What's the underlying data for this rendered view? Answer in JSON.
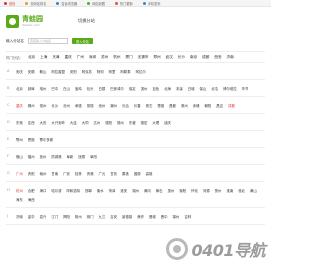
{
  "topbar": {
    "items": [
      "首页",
      "去网站排名",
      "告诉浏览器",
      "网站收藏",
      "热门更新",
      "手机发布"
    ],
    "colors": [
      "#d33",
      "#e0a020",
      "#2a8ad6",
      "#5aa919",
      "#e05050",
      "#2a8ad6"
    ]
  },
  "header": {
    "logo_title": "青蛙园",
    "logo_sub": "dxpoui.com",
    "city_switch": "切换分站"
  },
  "search": {
    "label": "输入分站名",
    "placeholder": "直接输入分站名",
    "button": "进入分站"
  },
  "hot": {
    "label": "热门分站：",
    "cities": [
      "北京",
      "上海",
      "天津",
      "重庆",
      "广州",
      "深圳",
      "苏州",
      "杭州",
      "厦门",
      "无锡市",
      "郑州",
      "武汉",
      "长沙",
      "南京",
      "成都",
      "西安",
      "济南"
    ]
  },
  "groups": [
    {
      "letter": "A",
      "cities": [
        "安庆",
        "安顺",
        "鞍山",
        "阿拉善盟",
        "安阳",
        "阿克苏",
        "阿坝",
        "阿里",
        "阿勒泰",
        "阿拉尔"
      ],
      "red": []
    },
    {
      "letter": "B",
      "cities": [
        "北京",
        "蚌埠",
        "亳州",
        "巴中",
        "白山",
        "宝鸡",
        "包头",
        "白银",
        "巴彦淖尔",
        "保定",
        "滨州",
        "百色",
        "北海",
        "本溪",
        "白城",
        "保山",
        "北屯",
        "博尔塔拉",
        "毕节"
      ],
      "red": []
    },
    {
      "letter": "C",
      "cities": [
        "重庆",
        "郴州",
        "常州",
        "长沙",
        "沧州",
        "承德",
        "常德",
        "池州",
        "潮州",
        "长治",
        "长春",
        "崇左",
        "楚雄",
        "昌都",
        "滁州",
        "赤峰",
        "朝阳",
        "昌吉",
        "成都"
      ],
      "red": [
        "重庆",
        "成都"
      ]
    },
    {
      "letter": "D",
      "cities": [
        "东莞",
        "定西",
        "大庆",
        "大兴安岭",
        "大连",
        "大同",
        "达州",
        "德阳",
        "德州",
        "东营",
        "德宏",
        "大理",
        "迪庆"
      ],
      "red": []
    },
    {
      "letter": "E",
      "cities": [
        "鄂州",
        "恩施",
        "鄂尔多斯"
      ],
      "red": []
    },
    {
      "letter": "F",
      "cities": [
        "佛山",
        "福州",
        "抚州",
        "防城港",
        "阜新",
        "抚顺",
        "阜阳"
      ],
      "red": []
    },
    {
      "letter": "G",
      "cities": [
        "广州",
        "贵阳",
        "赣州",
        "甘南",
        "广安",
        "桂林",
        "贵港",
        "广元",
        "甘孜",
        "果洛",
        "固原",
        "高雄"
      ],
      "red": [
        "广州"
      ]
    },
    {
      "letter": "H",
      "cities": [
        "杭州",
        "合肥",
        "海口",
        "哈尔滨",
        "呼和浩特",
        "邯郸",
        "衡水",
        "菏泽",
        "淮安",
        "湖州",
        "黄冈",
        "黄石",
        "惠州",
        "衡阳",
        "怀化",
        "河源",
        "贺州",
        "淮南",
        "淮北",
        "黄山",
        "海东",
        "海西"
      ],
      "red": [
        "杭州"
      ]
    },
    {
      "letter": "J",
      "cities": [
        "济南",
        "金华",
        "嘉兴",
        "江门",
        "揭阳",
        "荆州",
        "荆门",
        "九江",
        "吉安",
        "景德镇",
        "焦作",
        "晋城",
        "晋中",
        "锦州",
        "吉林"
      ],
      "red": []
    }
  ],
  "watermark": "0401导航"
}
